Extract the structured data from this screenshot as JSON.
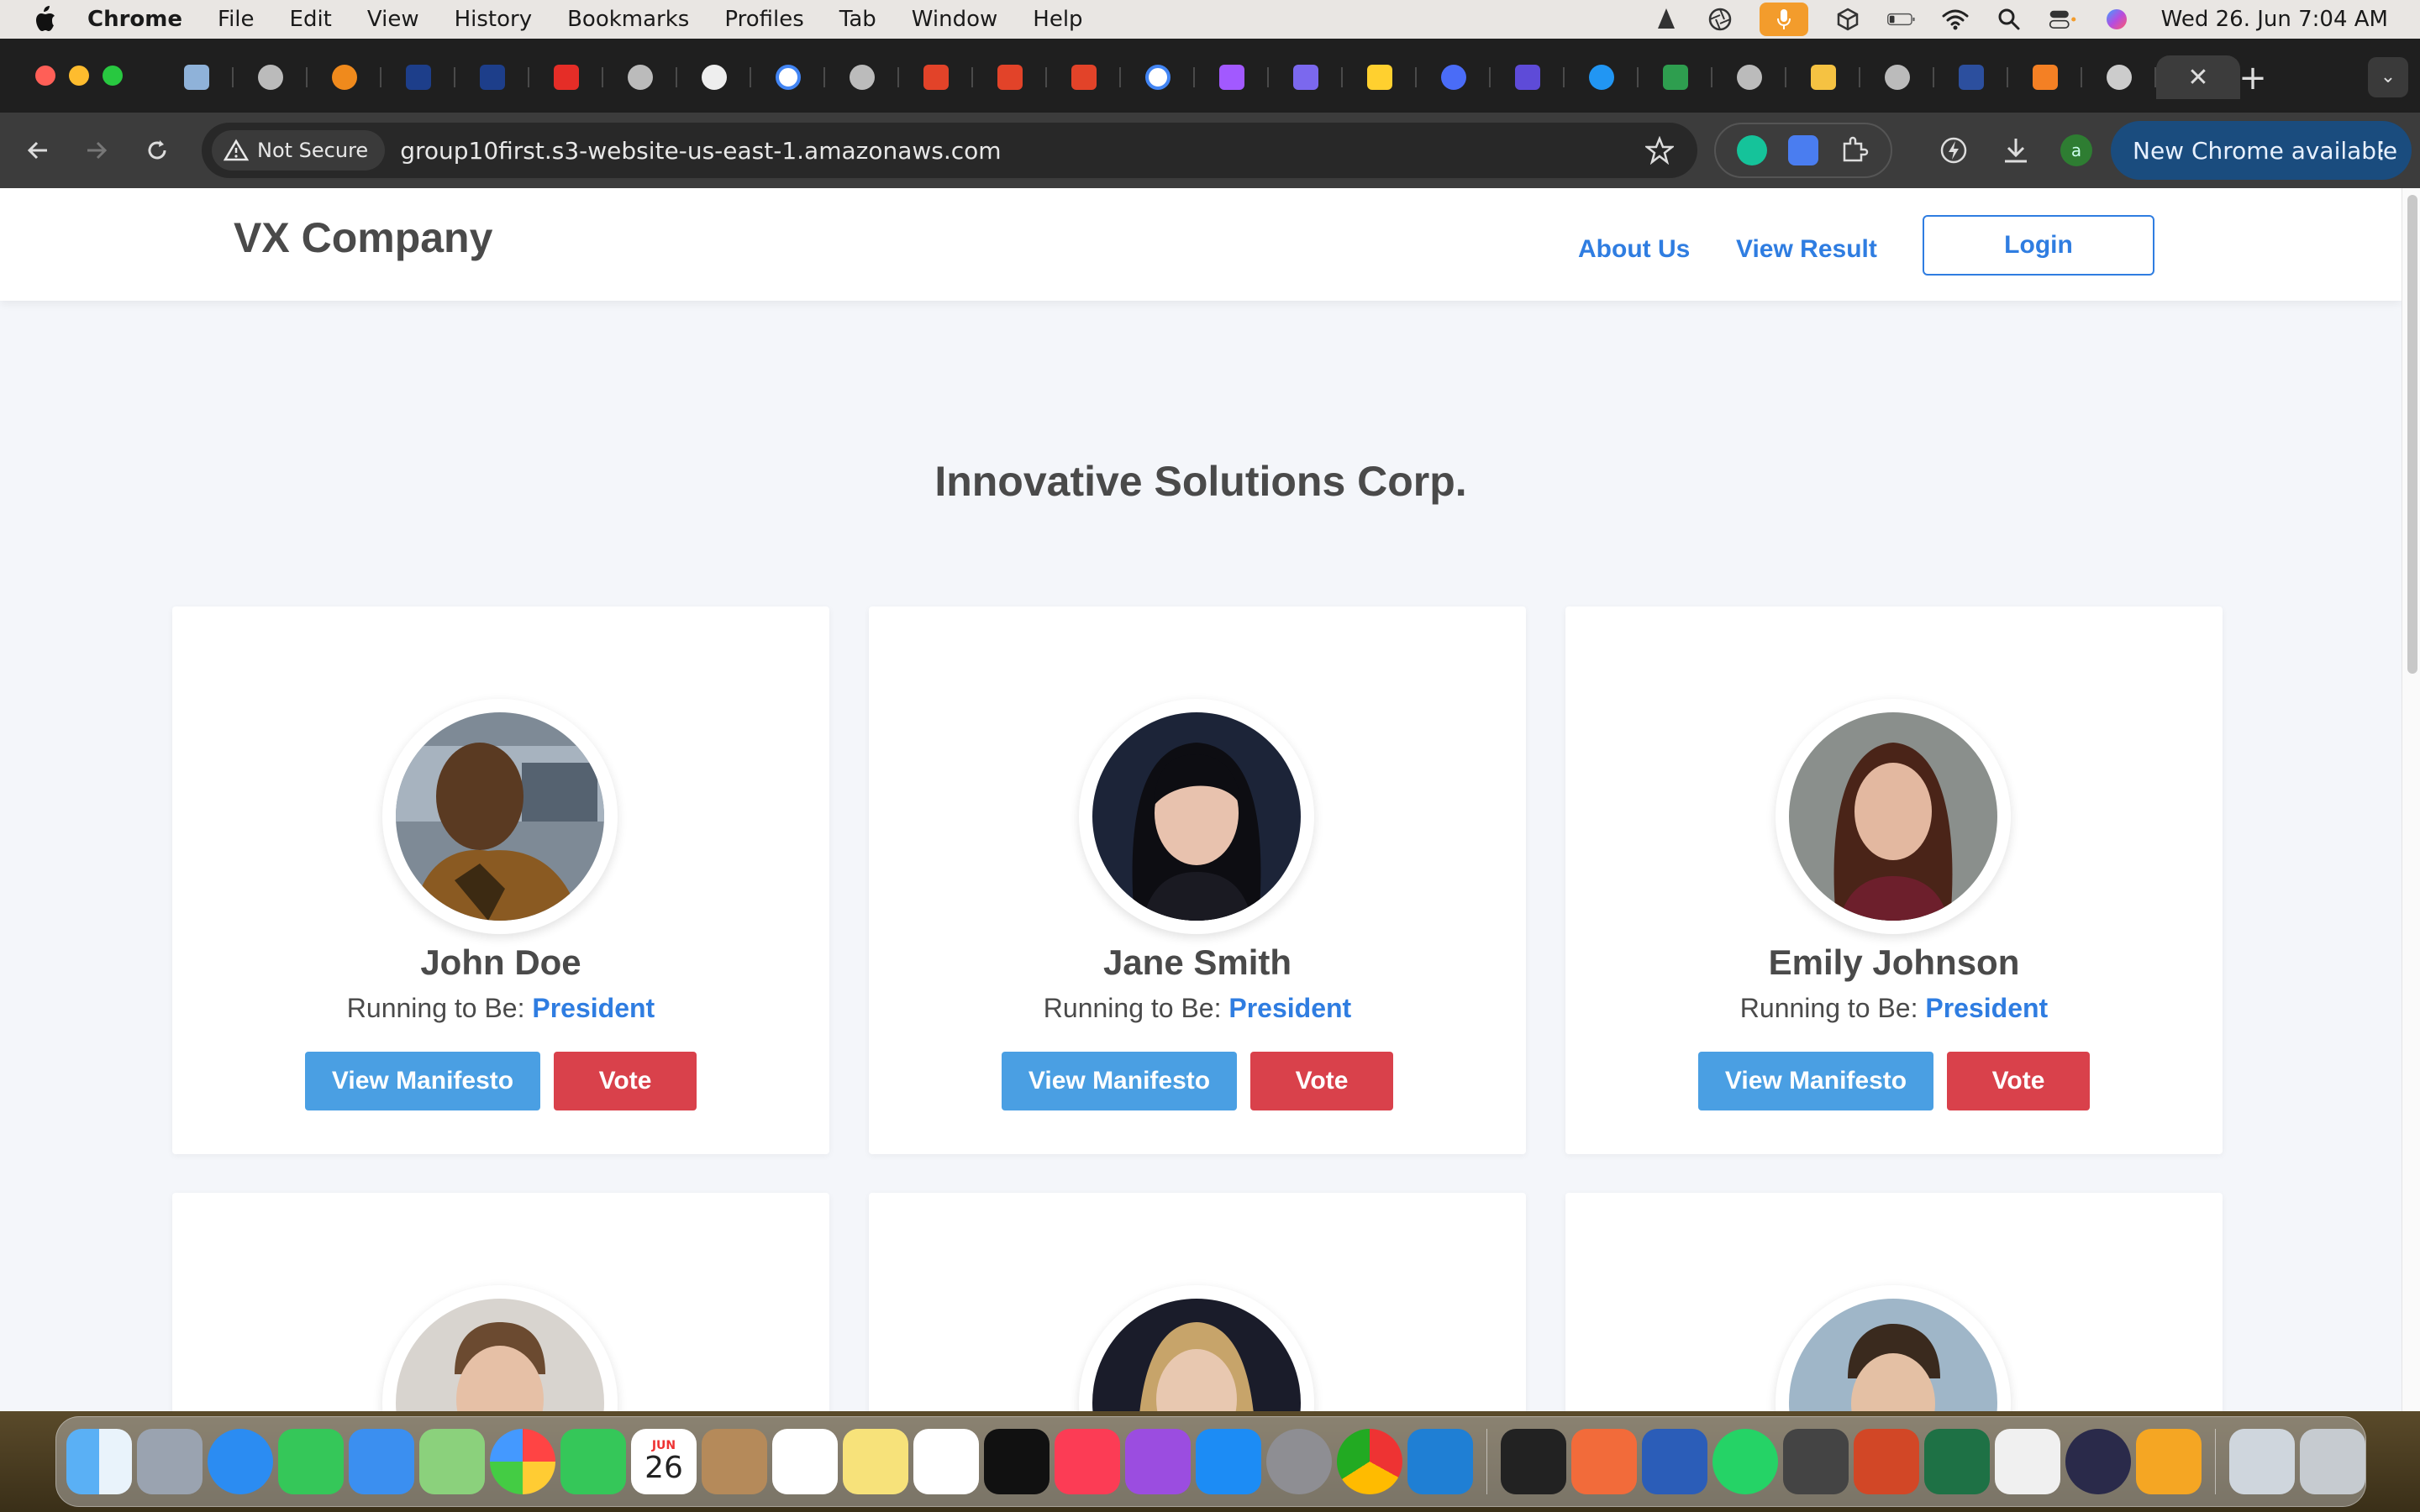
{
  "menubar": {
    "app_name": "Chrome",
    "menus": [
      "File",
      "Edit",
      "View",
      "History",
      "Bookmarks",
      "Profiles",
      "Tab",
      "Window",
      "Help"
    ],
    "clock": "Wed 26. Jun  7:04 AM"
  },
  "browser": {
    "security_label": "Not Secure",
    "url": "group10first.s3-website-us-east-1.amazonaws.com",
    "update_label": "New Chrome available",
    "profile_initial": "a"
  },
  "site": {
    "brand": "VX Company",
    "nav": {
      "about": "About Us",
      "results": "View Result",
      "login": "Login"
    },
    "company_title": "Innovative Solutions Corp.",
    "running_label": "Running to Be: ",
    "manifesto_label": "View Manifesto",
    "vote_label": "Vote",
    "candidates": [
      {
        "name": "John Doe",
        "position": "President"
      },
      {
        "name": "Jane Smith",
        "position": "President"
      },
      {
        "name": "Emily Johnson",
        "position": "President"
      }
    ]
  },
  "dock": {
    "calendar_month": "JUN",
    "calendar_day": "26"
  },
  "colors": {
    "accent": "#2f7de1",
    "manifesto_button": "#4a9fe3",
    "vote_button": "#d9414b",
    "page_background": "#f4f6fa"
  }
}
